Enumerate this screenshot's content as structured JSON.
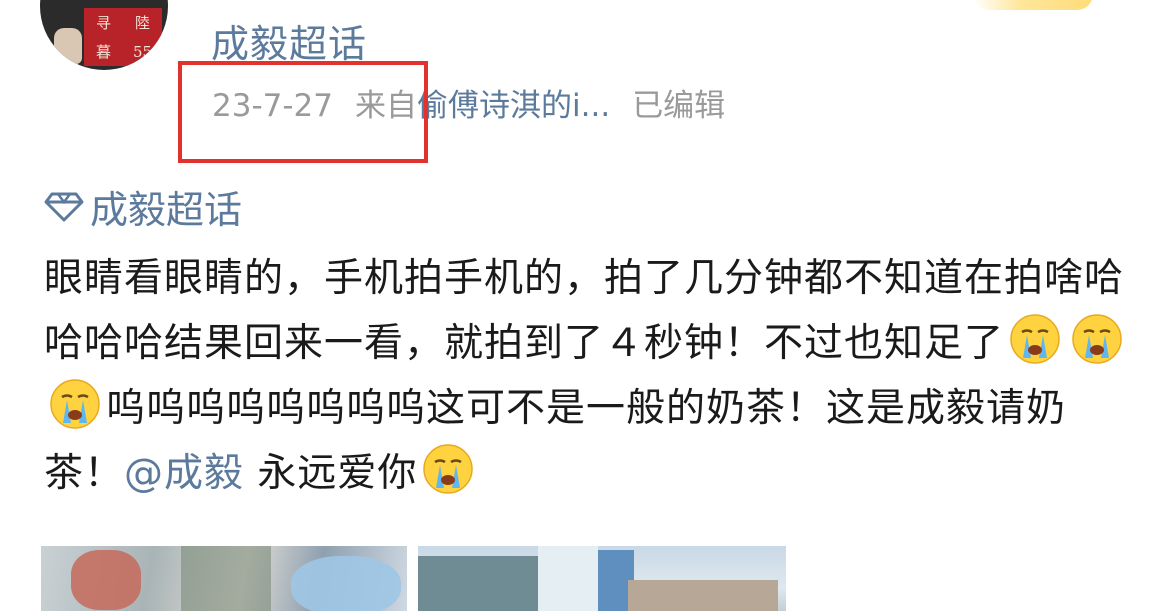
{
  "post": {
    "username": "成毅超话",
    "date": "23-7-27",
    "source_prefix": "来自",
    "source_name": "偷傅诗淇的i...",
    "edited": "已编辑",
    "topic": "成毅超话",
    "text_part1": "眼睛看眼睛的，手机拍手机的，拍了几分钟都不知道在拍啥哈哈哈哈结果回来一看，就拍到了４秒钟！不过也知足了",
    "text_part2": "呜呜呜呜呜呜呜呜这可不是一般的奶茶！这是成毅请奶茶！",
    "mention": "@成毅",
    "text_part3": " 永远爱你",
    "emoji_name": "crying-face"
  },
  "avatar": {
    "seal_chars": [
      "寻",
      "陸",
      "暮",
      "55"
    ]
  },
  "colors": {
    "link": "#5b7a9c",
    "meta": "#9a9a9a",
    "text": "#1a1a1a",
    "highlight": "#e1322e"
  }
}
